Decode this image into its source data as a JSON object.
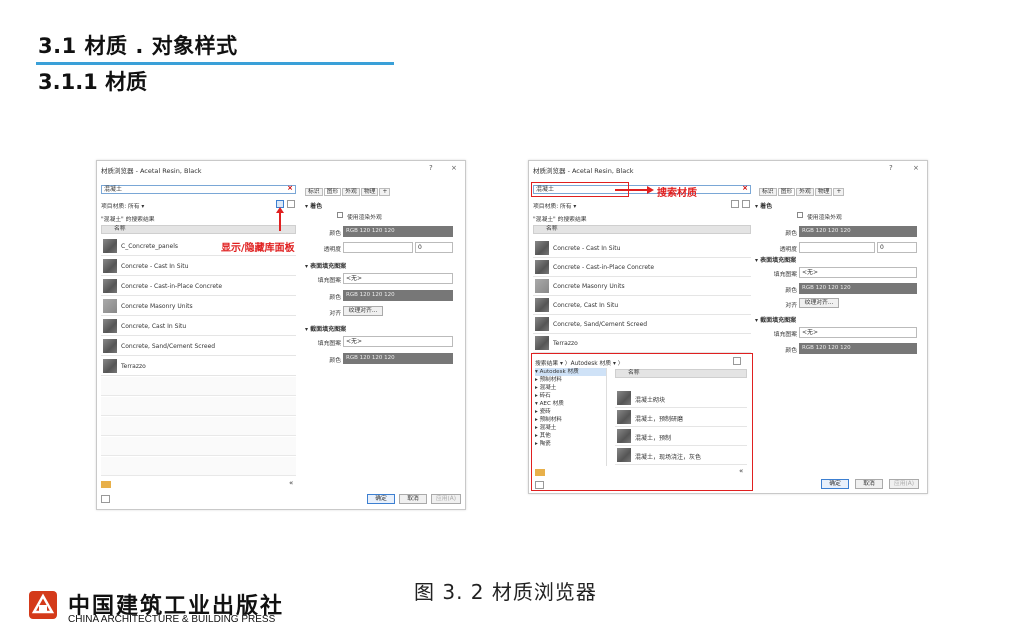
{
  "heading": {
    "h1": "3.1 材质 . 对象样式",
    "h2": "3.1.1 材质"
  },
  "caption": "图 3. 2 材质浏览器",
  "publisher": {
    "name_cn": "中国建筑工业出版社",
    "name_en": "CHINA ARCHITECTURE & BUILDING PRESS"
  },
  "dialog1": {
    "title": "材质浏览器 - Acetal Resin, Black",
    "ctrl_help": "?",
    "ctrl_close": "×",
    "search_value": "混凝土",
    "project_materials": "项目材质: 所有 ▾",
    "search_results_label": "\"混凝土\" 的搜索结果",
    "col_name": "名称",
    "materials": [
      "C_Concrete_panels",
      "Concrete - Cast In Situ",
      "Concrete - Cast-in-Place Concrete",
      "Concrete Masonry Units",
      "Concrete, Cast In Situ",
      "Concrete, Sand/Cement Screed",
      "Terrazzo"
    ],
    "annotation": "显示/隐藏库面板",
    "tabs": [
      "标识",
      "图形",
      "外观",
      "物理",
      "+"
    ],
    "sec_shading": "▾ 着色",
    "use_render": "使用渲染外观",
    "color_label": "颜色",
    "color_value": "RGB 120 120 120",
    "transparency_label": "透明度",
    "transparency_value": "0",
    "sec_surface": "▾ 表面填充图案",
    "fill_pattern_label": "填充图案",
    "fill_pattern_value": "<无>",
    "align_label": "对齐",
    "align_button": "纹理对齐...",
    "sec_cut": "▾ 截面填充图案",
    "ok": "确定",
    "cancel": "取消",
    "apply": "应用(A)",
    "collapse": "«"
  },
  "dialog2": {
    "title": "材质浏览器 - Acetal Resin, Black",
    "ctrl_help": "?",
    "ctrl_close": "×",
    "search_value": "混凝土",
    "search_annotation": "搜索材质",
    "project_materials": "项目材质: 所有 ▾",
    "search_results_label": "\"混凝土\" 的搜索结果",
    "col_name": "名称",
    "materials": [
      "Concrete - Cast In Situ",
      "Concrete - Cast-in-Place Concrete",
      "Concrete Masonry Units",
      "Concrete, Cast In Situ",
      "Concrete, Sand/Cement Screed",
      "Terrazzo"
    ],
    "lib_header": "搜索结果 ▾ 〉Autodesk 材质 ▾ 〉",
    "tree": [
      "▾ Autodesk 材质",
      "  ▸ 预制材料",
      "  ▸ 混凝土",
      "  ▸ 砖石",
      "▾ AEC 材质",
      "  ▸ 瓷砖",
      "  ▸ 预制材料",
      "  ▸ 混凝土",
      "  ▸ 其他",
      "  ▸ 陶瓷"
    ],
    "lib_col_name": "名称",
    "lib_items": [
      "混凝土砌块",
      "混凝土，预制研磨",
      "混凝土，预制",
      "混凝土，现场浇注，灰色"
    ],
    "tabs": [
      "标识",
      "图形",
      "外观",
      "物理",
      "+"
    ],
    "sec_shading": "▾ 着色",
    "use_render": "使用渲染外观",
    "color_label": "颜色",
    "color_value": "RGB 120 120 120",
    "transparency_label": "透明度",
    "transparency_value": "0",
    "sec_surface": "▾ 表面填充图案",
    "fill_pattern_label": "填充图案",
    "fill_pattern_value": "<无>",
    "align_label": "对齐",
    "align_button": "纹理对齐...",
    "sec_cut": "▾ 截面填充图案",
    "ok": "确定",
    "cancel": "取消",
    "apply": "应用(A)",
    "collapse": "«"
  }
}
